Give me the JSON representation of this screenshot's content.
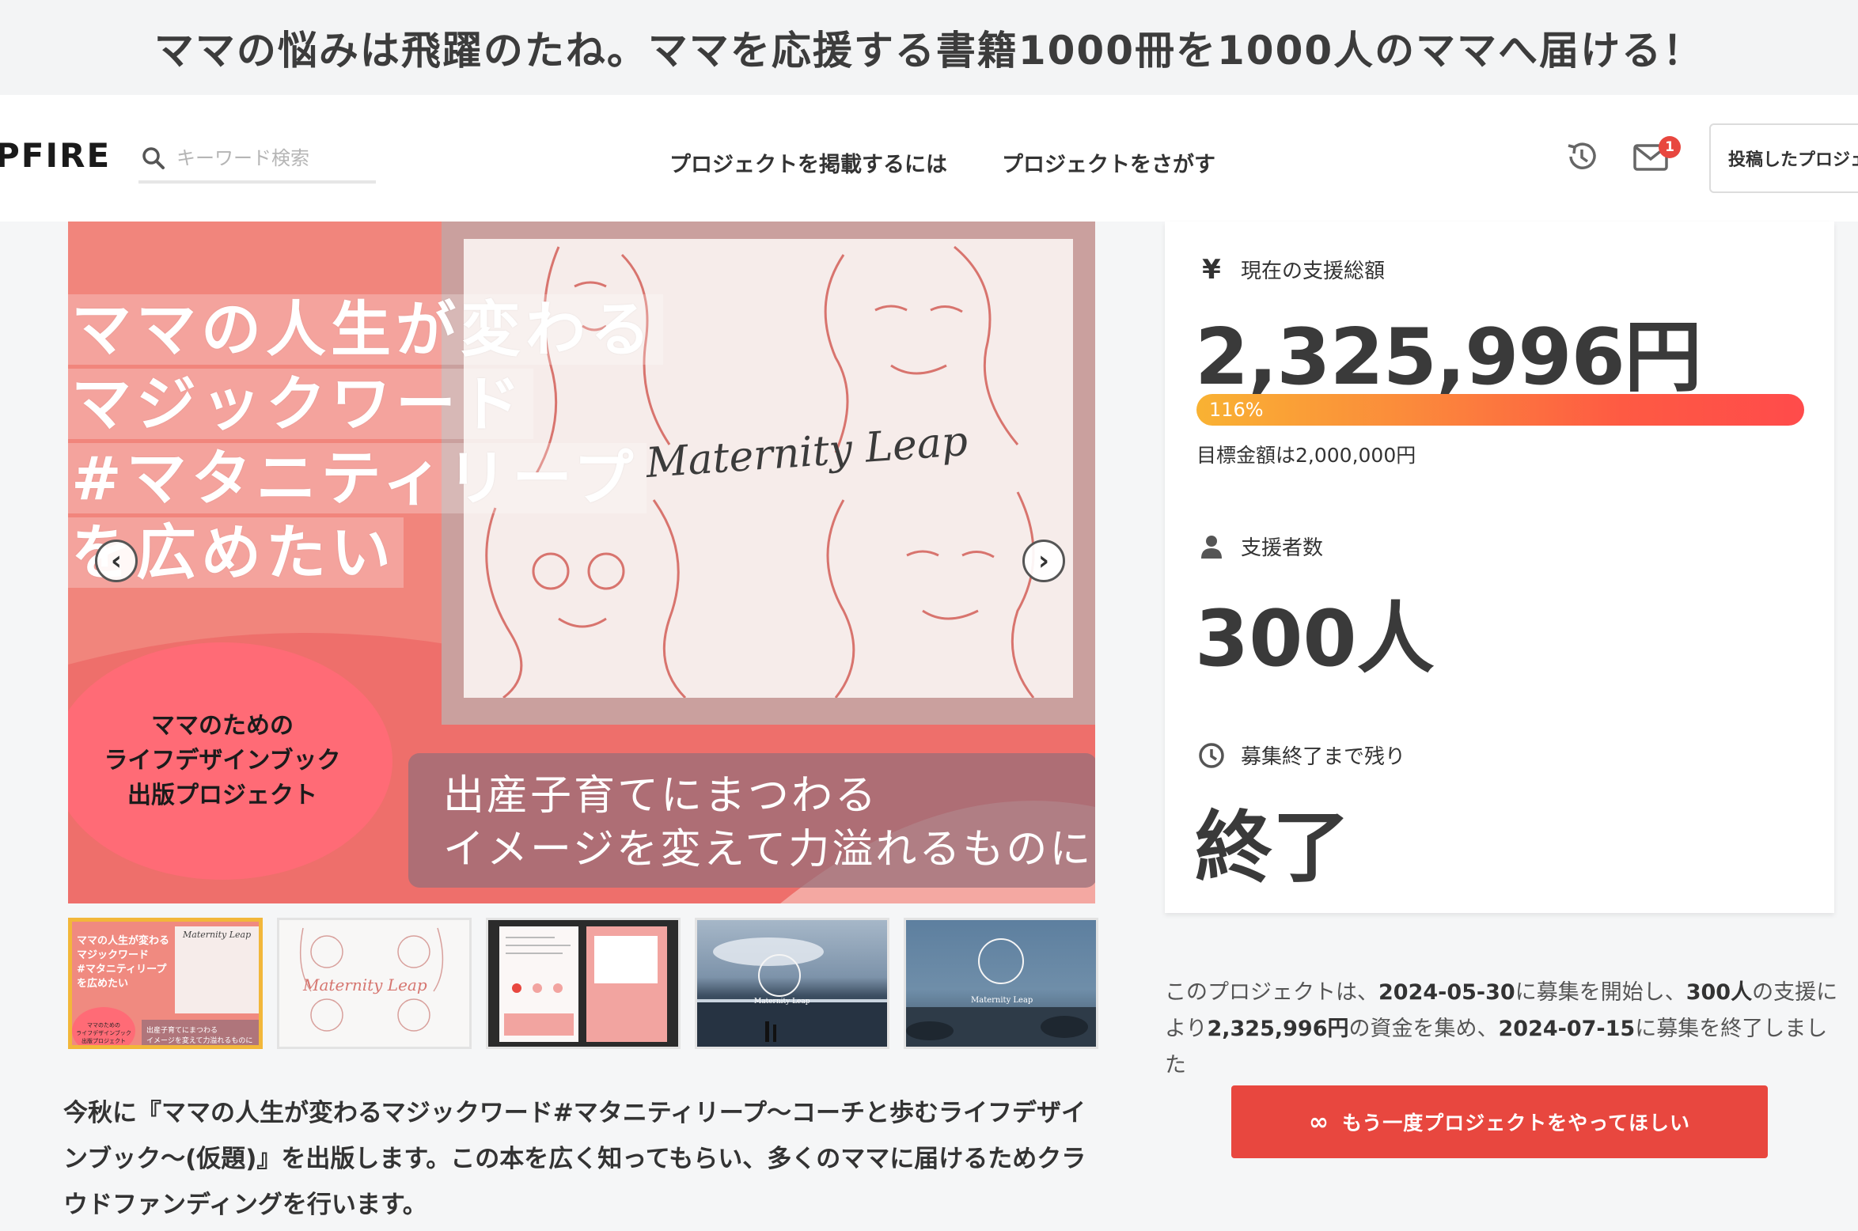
{
  "page_title": "ママの悩みは飛躍のたね。ママを応援する書籍1000冊を1000人のママへ届ける！",
  "header": {
    "logo": "PFIRE",
    "search_placeholder": "キーワード検索",
    "nav": [
      "プロジェクトを掲載するには",
      "プロジェクトをさがす"
    ],
    "notification_count": "1",
    "posted_projects_label": "投稿したプロジェ"
  },
  "hero": {
    "title_lines": [
      "ママの人生が変わる",
      "マジックワード",
      "#マタニティリープ",
      "を広めたい"
    ],
    "brand_script": "Maternity Leap",
    "circle_lines": [
      "ママのための",
      "ライフデザインブック",
      "出版プロジェクト"
    ],
    "subtitle_lines": [
      "出産子育てにまつわる",
      "イメージを変えて力溢れるものに"
    ],
    "prev_label": "‹",
    "next_label": "›"
  },
  "thumbnails": {
    "t1_title": "ママの人生が変わる\nマジックワード\n#マタニティリープ\nを広めたい",
    "t1_circle": "ママのための\nライフデザインブック\n出版プロジェクト",
    "t1_sub": "出産子育てにまつわる\nイメージを変えて力溢れるものに",
    "t1_script": "Maternity Leap",
    "t2_script": "Maternity Leap",
    "t4_caption": "Maternity Leap",
    "t5_caption": "Maternity Leap"
  },
  "description": "今秋に『ママの人生が変わるマジックワード#マタニティリープ〜コーチと歩むライフデザインブック〜(仮題)』を出版します。この本を広く知ってもらい、多くのママに届けるためクラウドファンディングを行います。",
  "stats": {
    "total_label": "現在の支援総額",
    "total_icon": "¥",
    "total_amount": "2,325,996円",
    "progress_text": "116%",
    "progress_percent": 116,
    "goal_text": "目標金額は2,000,000円",
    "supporters_label": "支援者数",
    "supporters_value": "300人",
    "remaining_label": "募集終了まで残り",
    "remaining_value": "終了"
  },
  "summary": {
    "p1": "このプロジェクトは、",
    "start_date": "2024-05-30",
    "p2": "に募集を開始し、",
    "supporters": "300人",
    "p3": "の支援により",
    "amount": "2,325,996円",
    "p4": "の資金を集め、",
    "end_date": "2024-07-15",
    "p5": "に募集を終了しました"
  },
  "again_button": {
    "icon": "∞",
    "label": "もう一度プロジェクトをやってほしい"
  },
  "colors": {
    "accent_red": "#e8473f",
    "progress_start": "#f9b233",
    "progress_end": "#ff4b4b",
    "thumb_active_border": "#f2b73a",
    "hero_bg": "#f1857c"
  }
}
